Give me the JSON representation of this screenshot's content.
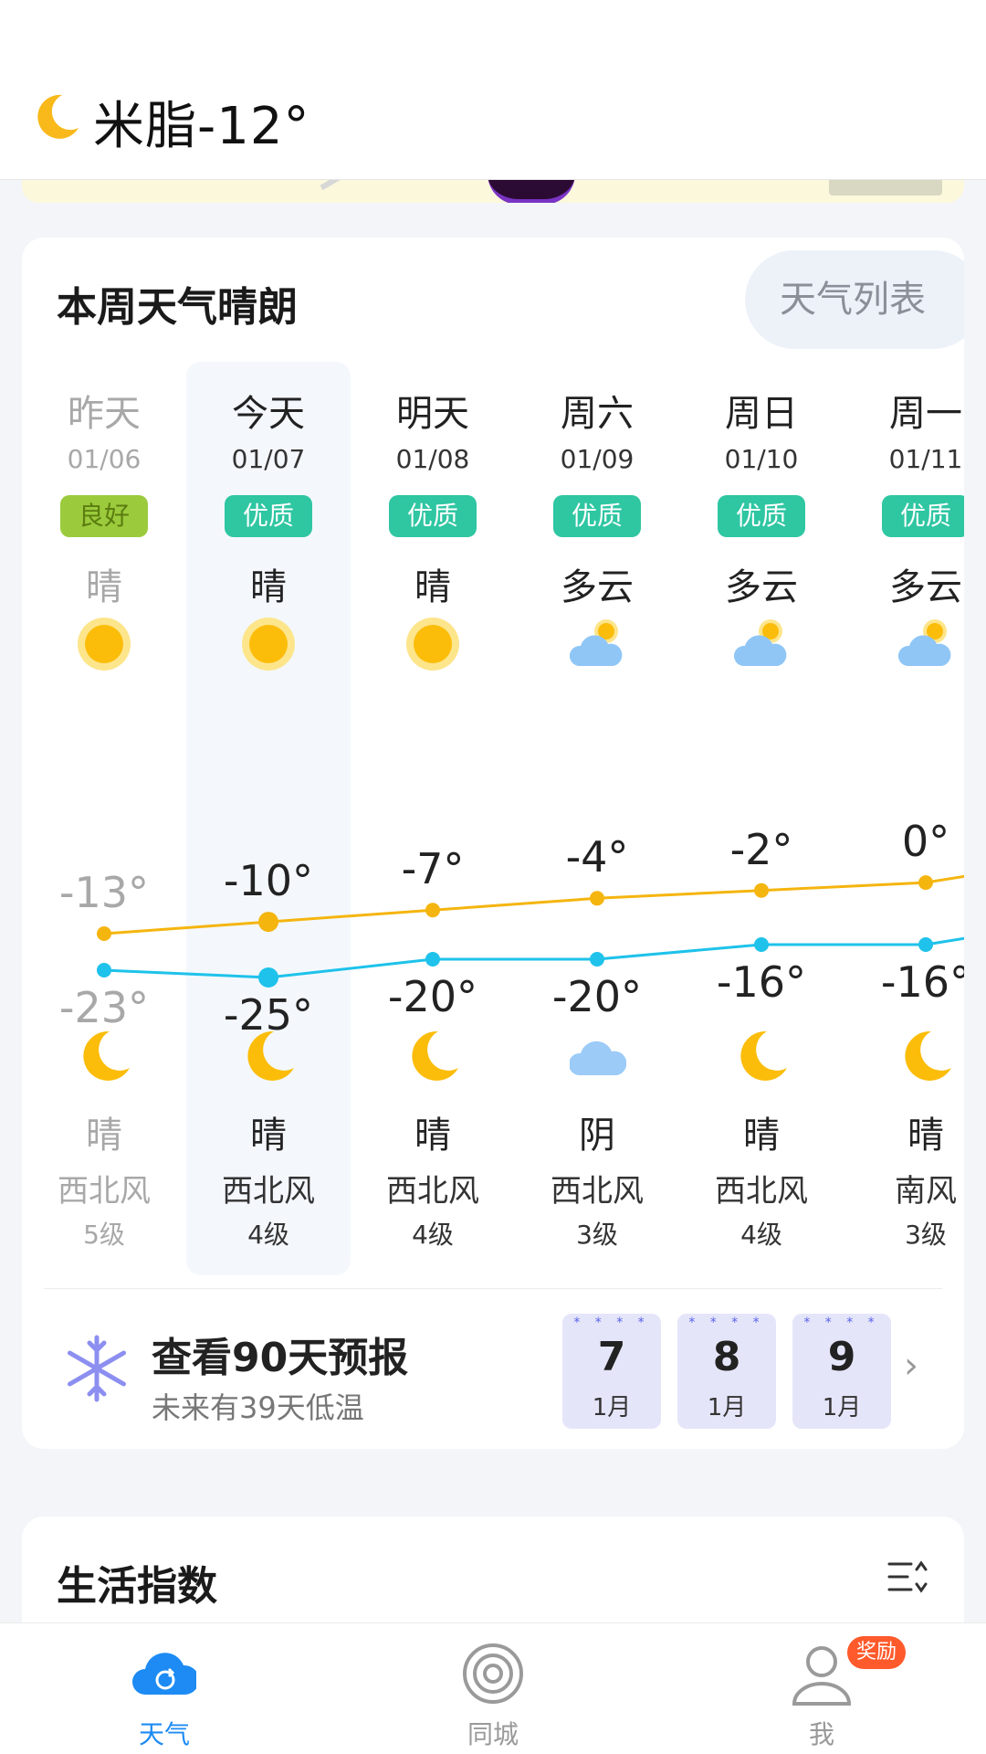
{
  "header": {
    "title": "米脂-12°",
    "icon": "crescent-moon"
  },
  "week": {
    "title": "本周天气晴朗",
    "list_button": "天气列表",
    "days": [
      {
        "name": "昨天",
        "date": "01/06",
        "aqi": "良好",
        "day_cond": "晴",
        "day_icon": "sun",
        "high": "-13°",
        "low": "-23°",
        "night_icon": "moon",
        "night_cond": "晴",
        "wind": "西北风",
        "level": "5级"
      },
      {
        "name": "今天",
        "date": "01/07",
        "aqi": "优质",
        "day_cond": "晴",
        "day_icon": "sun",
        "high": "-10°",
        "low": "-25°",
        "night_icon": "moon",
        "night_cond": "晴",
        "wind": "西北风",
        "level": "4级"
      },
      {
        "name": "明天",
        "date": "01/08",
        "aqi": "优质",
        "day_cond": "晴",
        "day_icon": "sun",
        "high": "-7°",
        "low": "-20°",
        "night_icon": "moon",
        "night_cond": "晴",
        "wind": "西北风",
        "level": "4级"
      },
      {
        "name": "周六",
        "date": "01/09",
        "aqi": "优质",
        "day_cond": "多云",
        "day_icon": "cloud-sun",
        "high": "-4°",
        "low": "-20°",
        "night_icon": "cloud",
        "night_cond": "阴",
        "wind": "西北风",
        "level": "3级"
      },
      {
        "name": "周日",
        "date": "01/10",
        "aqi": "优质",
        "day_cond": "多云",
        "day_icon": "cloud-sun",
        "high": "-2°",
        "low": "-16°",
        "night_icon": "moon",
        "night_cond": "晴",
        "wind": "西北风",
        "level": "4级"
      },
      {
        "name": "周一",
        "date": "01/11",
        "aqi": "优质",
        "day_cond": "多云",
        "day_icon": "cloud-sun",
        "high": "0°",
        "low": "-16°",
        "night_icon": "moon",
        "night_cond": "晴",
        "wind": "南风",
        "level": "3级"
      }
    ],
    "high_temps": [
      -13,
      -10,
      -7,
      -4,
      -2,
      0
    ],
    "low_temps": [
      -23,
      -25,
      -20,
      -20,
      -16,
      -16
    ],
    "colors": {
      "high_line": "#f5b50f",
      "low_line": "#1ec2ea",
      "aqi_good": "#2fc6a2",
      "aqi_fair": "#9bcb3c"
    }
  },
  "forecast": {
    "title": "查看90天预报",
    "subtitle": "未来有39天低温",
    "days": [
      {
        "num": "7",
        "month": "1月"
      },
      {
        "num": "8",
        "month": "1月"
      },
      {
        "num": "9",
        "month": "1月"
      }
    ]
  },
  "life": {
    "title": "生活指数"
  },
  "nav": {
    "items": [
      {
        "label": "天气",
        "icon": "weather-cloud-icon"
      },
      {
        "label": "同城",
        "icon": "radar-icon"
      },
      {
        "label": "我",
        "icon": "user-icon"
      }
    ],
    "badge": "奖励",
    "active_color": "#1d8bf3"
  }
}
